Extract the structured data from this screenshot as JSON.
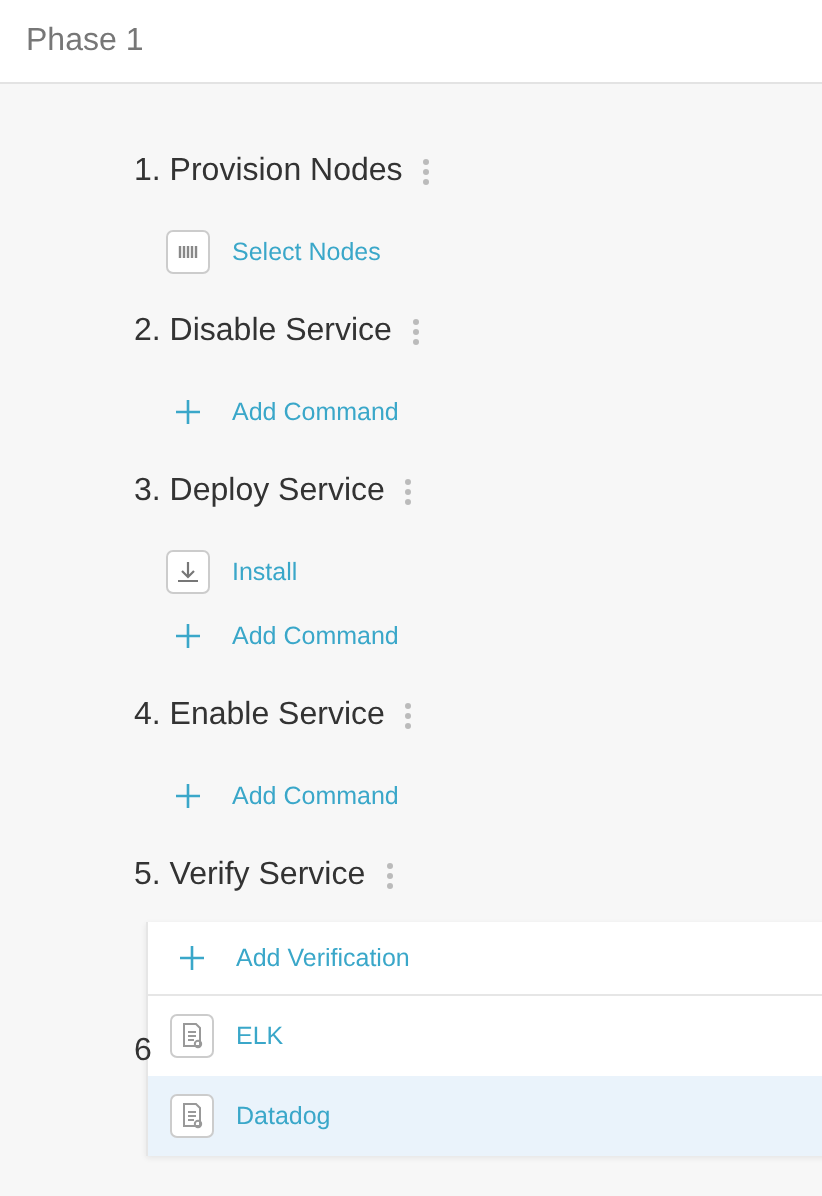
{
  "header": {
    "title": "Phase 1"
  },
  "steps": [
    {
      "title": "1. Provision Nodes",
      "items": [
        {
          "kind": "nodes",
          "label": "Select Nodes"
        }
      ]
    },
    {
      "title": "2. Disable Service",
      "items": [
        {
          "kind": "add",
          "label": "Add Command"
        }
      ]
    },
    {
      "title": "3. Deploy Service",
      "items": [
        {
          "kind": "install",
          "label": "Install"
        },
        {
          "kind": "add",
          "label": "Add Command"
        }
      ]
    },
    {
      "title": "4. Enable Service",
      "items": [
        {
          "kind": "add",
          "label": "Add Command"
        }
      ]
    },
    {
      "title": "5. Verify Service",
      "menu": [
        {
          "kind": "add",
          "label": "Add Verification",
          "selected": false
        },
        {
          "kind": "doc",
          "label": "ELK",
          "selected": false
        },
        {
          "kind": "doc",
          "label": "Datadog",
          "selected": true
        }
      ]
    },
    {
      "title": "6"
    }
  ]
}
